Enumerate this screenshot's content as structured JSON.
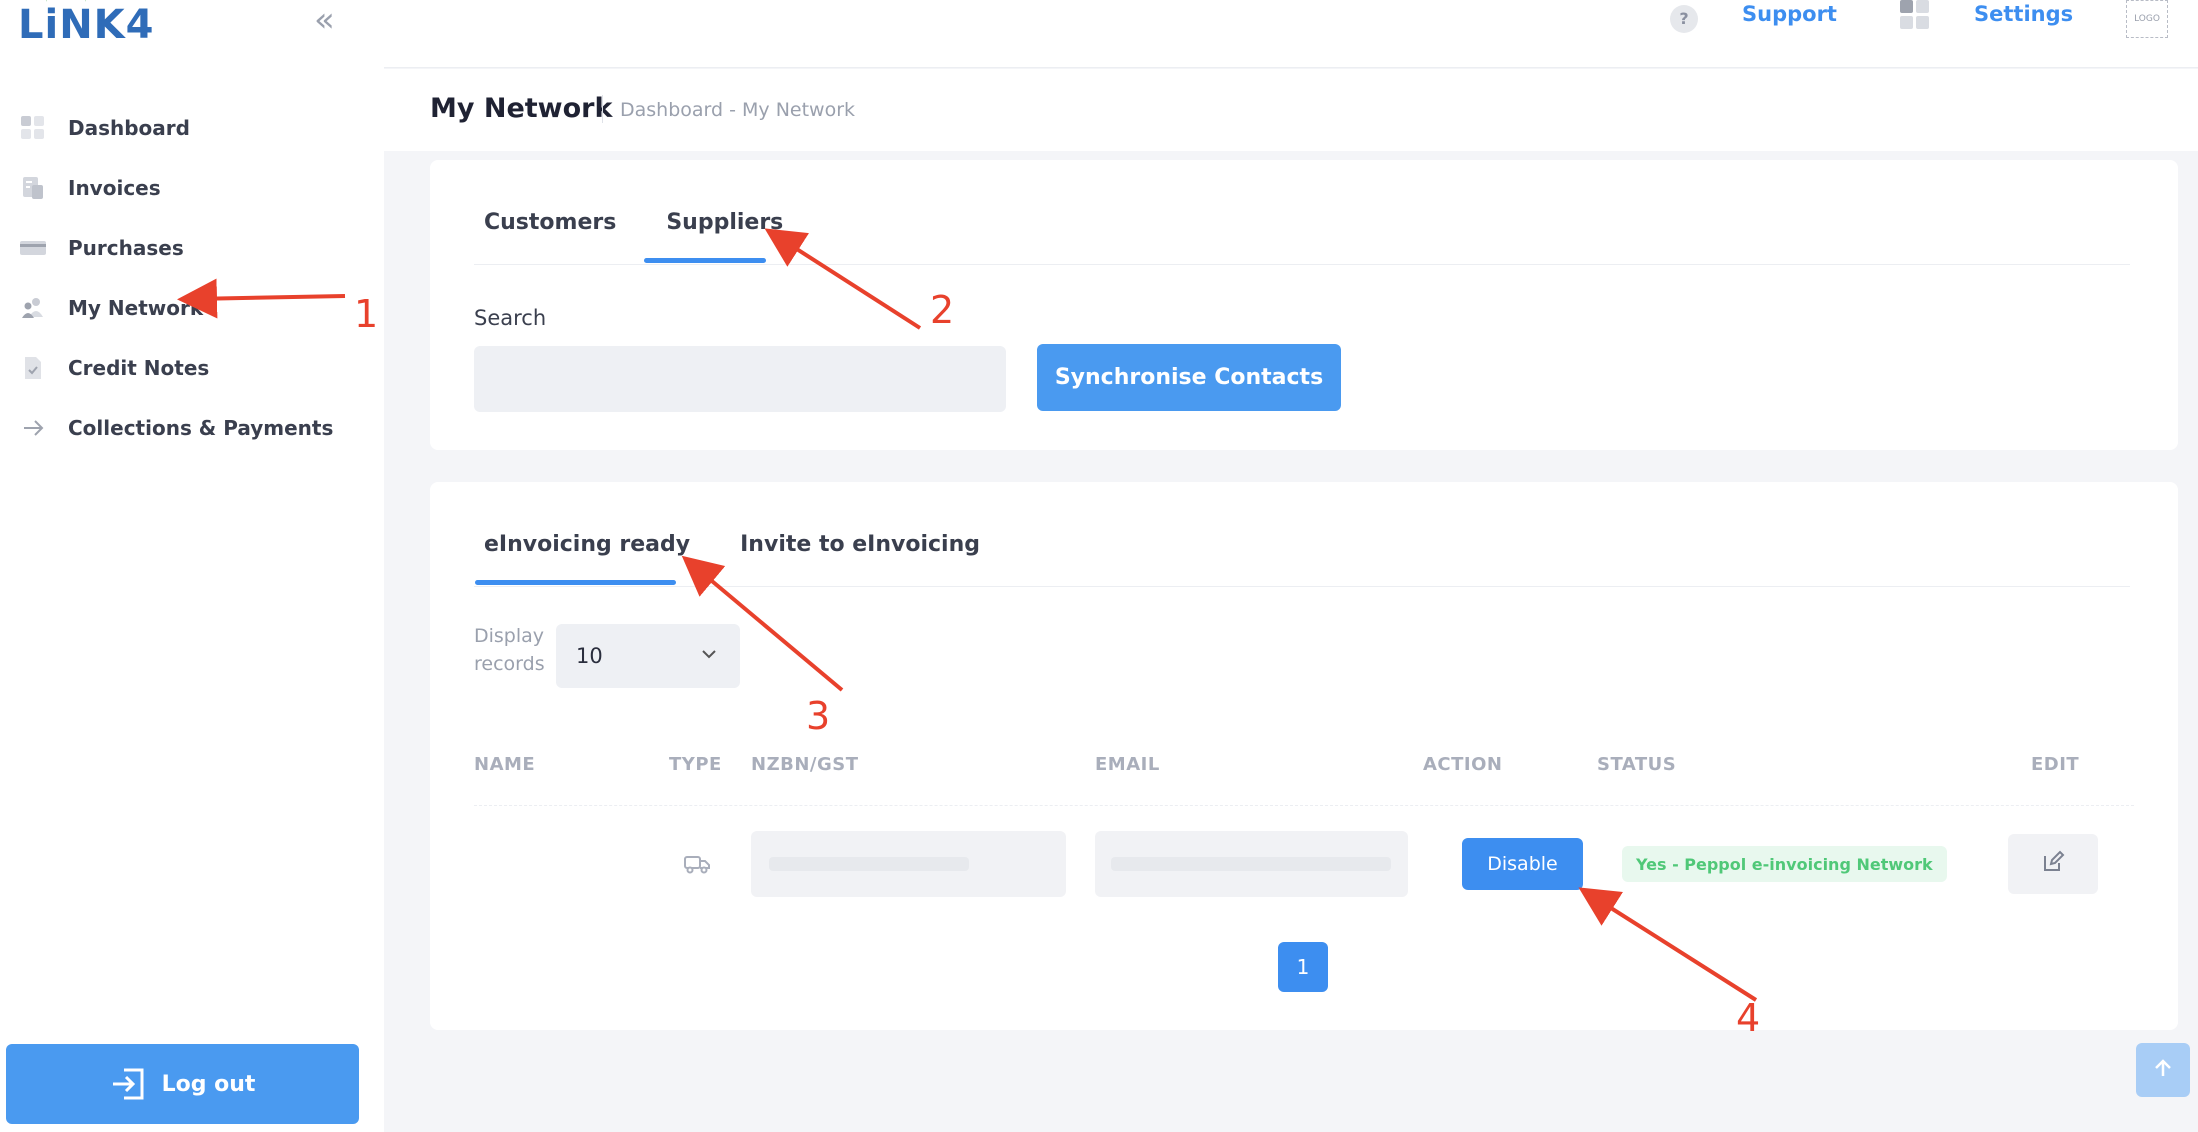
{
  "brand": {
    "logo_text": "LiNK4"
  },
  "sidebar": {
    "collapse_glyph": "«",
    "items": [
      {
        "label": "Dashboard",
        "icon": "dashboard-icon"
      },
      {
        "label": "Invoices",
        "icon": "invoice-icon"
      },
      {
        "label": "Purchases",
        "icon": "card-icon"
      },
      {
        "label": "My Network",
        "icon": "people-icon"
      },
      {
        "label": "Credit Notes",
        "icon": "document-check-icon"
      },
      {
        "label": "Collections & Payments",
        "icon": "arrow-right-icon"
      }
    ],
    "logout_label": "Log out"
  },
  "topbar": {
    "help_glyph": "?",
    "support_label": "Support",
    "settings_label": "Settings",
    "logo_placeholder": "LOGO"
  },
  "page": {
    "title": "My Network",
    "breadcrumb": "Dashboard - My Network"
  },
  "contact_tabs": {
    "customers": "Customers",
    "suppliers": "Suppliers",
    "active": "Suppliers"
  },
  "search": {
    "label": "Search",
    "value": "",
    "placeholder": ""
  },
  "sync_button_label": "Synchronise Contacts",
  "einvoicing_tabs": {
    "ready": "eInvoicing ready",
    "invite": "Invite to eInvoicing",
    "active": "eInvoicing ready"
  },
  "display_records": {
    "label_line1": "Display",
    "label_line2": "records",
    "value": "10"
  },
  "table": {
    "columns": [
      "NAME",
      "TYPE",
      "NZBN/GST",
      "EMAIL",
      "ACTION",
      "STATUS",
      "EDIT"
    ],
    "rows": [
      {
        "name": "",
        "type_icon": "truck-icon",
        "nzbn": "",
        "email": "",
        "action_label": "Disable",
        "status": "Yes - Peppol e-invoicing Network",
        "edit_icon": "edit-icon"
      }
    ]
  },
  "pagination": {
    "current_page": "1"
  },
  "annotations": {
    "color": "#e8412c",
    "labels": [
      "1",
      "2",
      "3",
      "4"
    ]
  },
  "colors": {
    "accent": "#3d8ef0",
    "status_green": "#50c878",
    "annotation_red": "#e8412c"
  }
}
